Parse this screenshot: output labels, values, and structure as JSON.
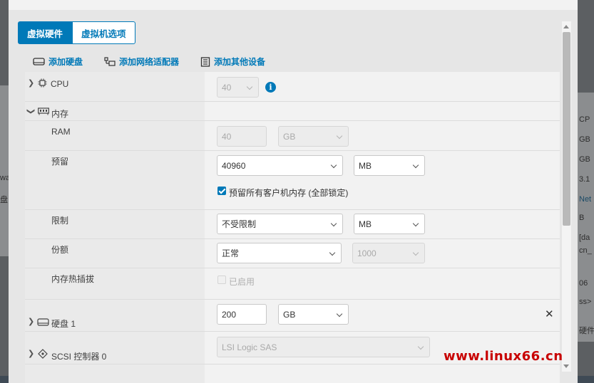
{
  "background": {
    "right_texts": [
      "CP",
      "GB",
      "GB",
      "3.1",
      "Net",
      "B",
      "[da",
      "cn_",
      "06",
      "ss>",
      "硬件"
    ],
    "left_texts": [
      "wa",
      "盘"
    ]
  },
  "tabs": [
    {
      "label": "虚拟硬件",
      "active": true
    },
    {
      "label": "虚拟机选项",
      "active": false
    }
  ],
  "toolbar": {
    "add_disk": "添加硬盘",
    "add_network": "添加网络适配器",
    "add_other": "添加其他设备"
  },
  "cpu": {
    "label": "CPU",
    "value": "40"
  },
  "memory": {
    "label": "内存",
    "ram": {
      "label": "RAM",
      "value": "40",
      "unit": "GB"
    },
    "reservation": {
      "label": "预留",
      "value": "40960",
      "unit": "MB",
      "lock_label": "预留所有客户机内存 (全部锁定)",
      "lock_checked": true
    },
    "limit": {
      "label": "限制",
      "value": "不受限制",
      "unit": "MB"
    },
    "shares": {
      "label": "份额",
      "value": "正常",
      "amount": "1000"
    },
    "hotplug": {
      "label": "内存热插拔",
      "checkbox_label": "已启用",
      "checked": false
    }
  },
  "disk": {
    "label": "硬盘 1",
    "value": "200",
    "unit": "GB"
  },
  "scsi": {
    "label": "SCSI 控制器 0",
    "value": "LSI Logic SAS"
  },
  "watermark": "www.linux66.cn",
  "colors": {
    "accent": "#0079b8",
    "watermark": "#c80000"
  }
}
